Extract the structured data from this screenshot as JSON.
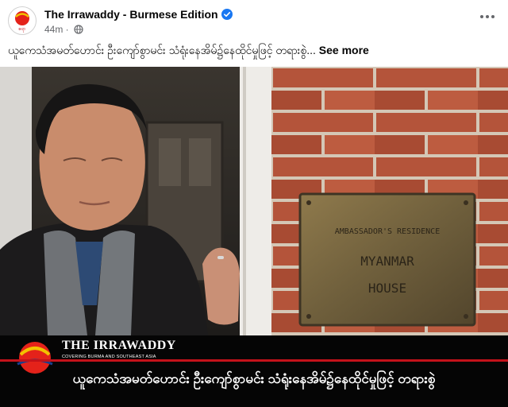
{
  "post": {
    "page_name": "The Irrawaddy - Burmese Edition",
    "time": "44m",
    "visibility_icon": "globe-icon",
    "verified_icon": "verified-badge-icon",
    "more_icon": "more-horizontal-icon",
    "avatar_text": "ဧရာ",
    "caption": "ယူကေသံအမတ်ဟောင်း ဦးကျော်စွာမင်း သံရုံးနေအိမ်၌နေထိုင်မှုဖြင့် တရားစွဲ...",
    "see_more": "See more"
  },
  "image": {
    "plaque_line1": "AMBASSADOR'S RESIDENCE",
    "plaque_line2": "MYANMAR",
    "plaque_line3": "HOUSE",
    "brand_name": "THE IRRAWADDY",
    "brand_sub": "COVERING BURMA AND SOUTHEAST ASIA",
    "headline": "ယူကေသံအမတ်ဟောင်း ဦးကျော်စွာမင်း သံရုံးနေအိမ်၌နေထိုင်မှုဖြင့် တရားစွဲ"
  },
  "colors": {
    "brand_red": "#c4121a",
    "verified_blue": "#1877f2",
    "brick": "#b4543a"
  }
}
